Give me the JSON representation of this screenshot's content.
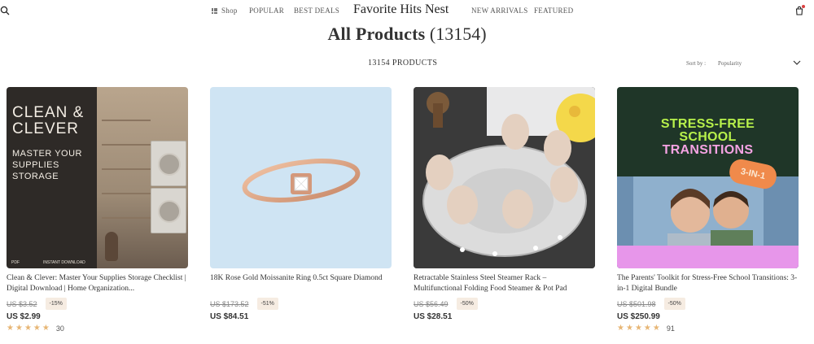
{
  "header": {
    "shop_label": "Shop",
    "nav_popular": "POPULAR",
    "nav_best_deals": "BEST DEALS",
    "brand": "Favorite Hits Nest",
    "nav_new_arrivals": "NEW ARRIVALS",
    "nav_featured": "FEATURED"
  },
  "page": {
    "title": "All Products",
    "title_count": "(13154)",
    "products_count_label": "13154 PRODUCTS",
    "sort_label": "Sort by :",
    "sort_value": "Popularity"
  },
  "products": [
    {
      "name": "Clean & Clever: Master Your Supplies Storage Checklist | Digital Download | Home Organization...",
      "old_price": "US $3.52",
      "discount": "-15%",
      "price": "US $2.99",
      "rating": 5,
      "reviews": "30",
      "image_text_1": "CLEAN & CLEVER",
      "image_text_2": "MASTER YOUR SUPPLIES STORAGE",
      "image_tag_pdf": "PDF",
      "image_tag_download": "INSTANT DOWNLOAD"
    },
    {
      "name": "18K Rose Gold Moissanite Ring 0.5ct Square Diamond",
      "old_price": "US $173.52",
      "discount": "-51%",
      "price": "US $84.51"
    },
    {
      "name": "Retractable Stainless Steel Steamer Rack – Multifunctional Folding Food Steamer & Pot Pad",
      "old_price": "US $56.49",
      "discount": "-50%",
      "price": "US $28.51"
    },
    {
      "name": "The Parents' Toolkit for Stress-Free School Transitions: 3-in-1 Digital Bundle",
      "old_price": "US $501.98",
      "discount": "-50%",
      "price": "US $250.99",
      "rating": 5,
      "reviews": "91",
      "image_line_1": "STRESS-FREE",
      "image_line_2": "SCHOOL",
      "image_line_3": "TRANSITIONS",
      "image_badge": "3-IN-1"
    }
  ],
  "colors": {
    "star": "#e7b675",
    "badge_bg": "#f6ece2",
    "cart_dot": "#d94040"
  },
  "icons": [
    "search-icon",
    "grid-icon",
    "cart-icon",
    "chevron-down-icon",
    "star-icon"
  ]
}
